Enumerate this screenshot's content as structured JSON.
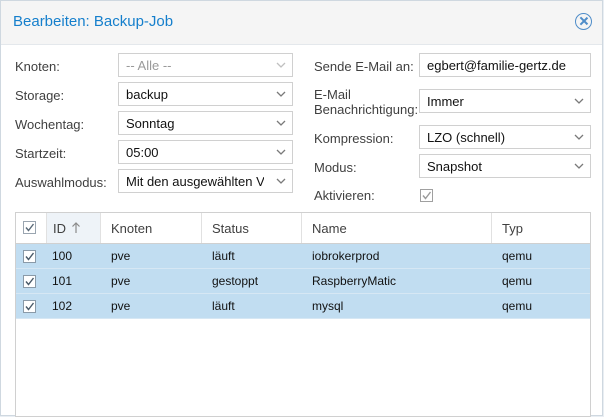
{
  "dialog": {
    "title": "Bearbeiten: Backup-Job"
  },
  "form": {
    "knoten": {
      "label": "Knoten:",
      "value": "-- Alle --"
    },
    "storage": {
      "label": "Storage:",
      "value": "backup"
    },
    "wochentag": {
      "label": "Wochentag:",
      "value": "Sonntag"
    },
    "startzeit": {
      "label": "Startzeit:",
      "value": "05:00"
    },
    "auswahlmodus": {
      "label": "Auswahlmodus:",
      "value": "Mit den ausgewählten V"
    },
    "email": {
      "label": "Sende E-Mail an:",
      "value": "egbert@familie-gertz.de"
    },
    "benachrichtigung": {
      "label_line1": "E-Mail",
      "label_line2": "Benachrichtigung:",
      "value": "Immer"
    },
    "kompression": {
      "label": "Kompression:",
      "value": "LZO (schnell)"
    },
    "modus": {
      "label": "Modus:",
      "value": "Snapshot"
    },
    "aktivieren": {
      "label": "Aktivieren:",
      "checked": true
    }
  },
  "grid": {
    "columns": [
      "ID",
      "Knoten",
      "Status",
      "Name",
      "Typ"
    ],
    "sort_icon": "arrow-up-icon",
    "rows": [
      {
        "id": "100",
        "knoten": "pve",
        "status": "läuft",
        "name": "iobrokerprod",
        "typ": "qemu",
        "selected": true
      },
      {
        "id": "101",
        "knoten": "pve",
        "status": "gestoppt",
        "name": "RaspberryMatic",
        "typ": "qemu",
        "selected": true
      },
      {
        "id": "102",
        "knoten": "pve",
        "status": "läuft",
        "name": "mysql",
        "typ": "qemu",
        "selected": true
      }
    ],
    "selection_color": "#c1ddf1"
  },
  "colors": {
    "title": "#157fcc",
    "header_bg": "#f5f5f5"
  }
}
